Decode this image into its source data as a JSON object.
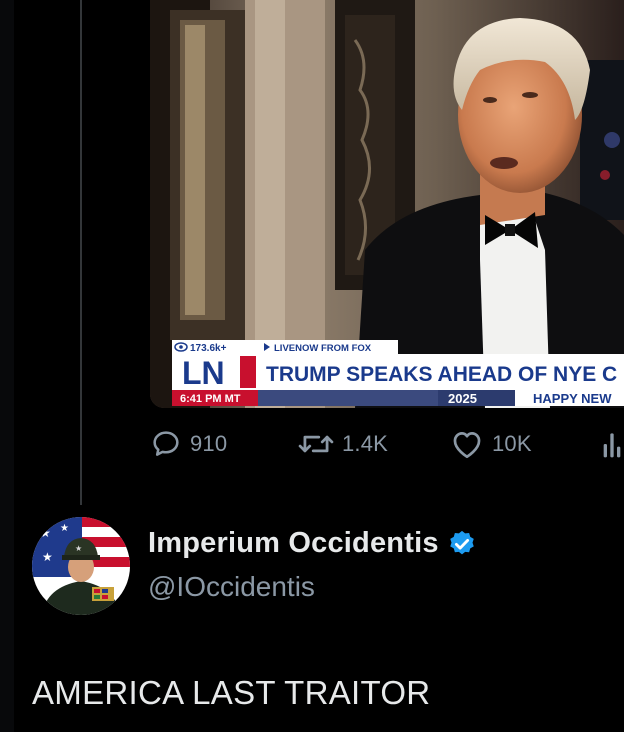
{
  "media": {
    "views": "173.6k+",
    "live_label": "LIVENOW FROM FOX",
    "network_logo": "LN",
    "time": "6:41 PM MT",
    "headline": "TRUMP SPEAKS AHEAD OF NYE C",
    "sub_year": "2025",
    "sub_text": "HAPPY NEW"
  },
  "actions": {
    "replies": "910",
    "reposts": "1.4K",
    "likes": "10K"
  },
  "author": {
    "display_name": "Imperium Occidentis",
    "handle": "@IOccidentis",
    "verified_color": "#1d9bf0"
  },
  "tweet": {
    "text": "AMERICA LAST TRAITOR"
  }
}
